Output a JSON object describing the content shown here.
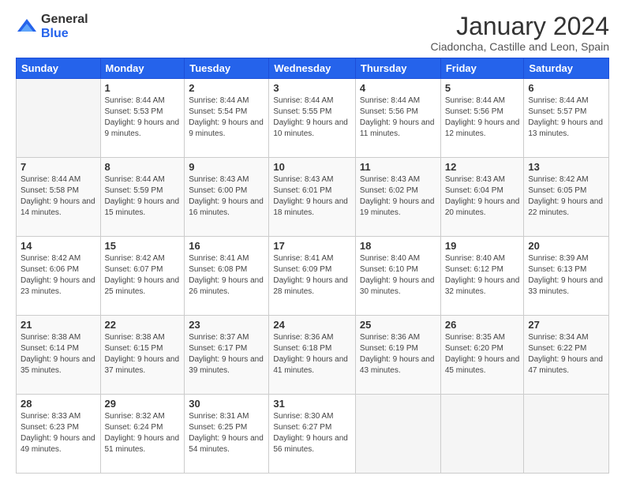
{
  "logo": {
    "general": "General",
    "blue": "Blue"
  },
  "header": {
    "month": "January 2024",
    "location": "Ciadoncha, Castille and Leon, Spain"
  },
  "weekdays": [
    "Sunday",
    "Monday",
    "Tuesday",
    "Wednesday",
    "Thursday",
    "Friday",
    "Saturday"
  ],
  "weeks": [
    [
      {
        "day": "",
        "sunrise": "",
        "sunset": "",
        "daylight": ""
      },
      {
        "day": "1",
        "sunrise": "Sunrise: 8:44 AM",
        "sunset": "Sunset: 5:53 PM",
        "daylight": "Daylight: 9 hours and 9 minutes."
      },
      {
        "day": "2",
        "sunrise": "Sunrise: 8:44 AM",
        "sunset": "Sunset: 5:54 PM",
        "daylight": "Daylight: 9 hours and 9 minutes."
      },
      {
        "day": "3",
        "sunrise": "Sunrise: 8:44 AM",
        "sunset": "Sunset: 5:55 PM",
        "daylight": "Daylight: 9 hours and 10 minutes."
      },
      {
        "day": "4",
        "sunrise": "Sunrise: 8:44 AM",
        "sunset": "Sunset: 5:56 PM",
        "daylight": "Daylight: 9 hours and 11 minutes."
      },
      {
        "day": "5",
        "sunrise": "Sunrise: 8:44 AM",
        "sunset": "Sunset: 5:56 PM",
        "daylight": "Daylight: 9 hours and 12 minutes."
      },
      {
        "day": "6",
        "sunrise": "Sunrise: 8:44 AM",
        "sunset": "Sunset: 5:57 PM",
        "daylight": "Daylight: 9 hours and 13 minutes."
      }
    ],
    [
      {
        "day": "7",
        "sunrise": "Sunrise: 8:44 AM",
        "sunset": "Sunset: 5:58 PM",
        "daylight": "Daylight: 9 hours and 14 minutes."
      },
      {
        "day": "8",
        "sunrise": "Sunrise: 8:44 AM",
        "sunset": "Sunset: 5:59 PM",
        "daylight": "Daylight: 9 hours and 15 minutes."
      },
      {
        "day": "9",
        "sunrise": "Sunrise: 8:43 AM",
        "sunset": "Sunset: 6:00 PM",
        "daylight": "Daylight: 9 hours and 16 minutes."
      },
      {
        "day": "10",
        "sunrise": "Sunrise: 8:43 AM",
        "sunset": "Sunset: 6:01 PM",
        "daylight": "Daylight: 9 hours and 18 minutes."
      },
      {
        "day": "11",
        "sunrise": "Sunrise: 8:43 AM",
        "sunset": "Sunset: 6:02 PM",
        "daylight": "Daylight: 9 hours and 19 minutes."
      },
      {
        "day": "12",
        "sunrise": "Sunrise: 8:43 AM",
        "sunset": "Sunset: 6:04 PM",
        "daylight": "Daylight: 9 hours and 20 minutes."
      },
      {
        "day": "13",
        "sunrise": "Sunrise: 8:42 AM",
        "sunset": "Sunset: 6:05 PM",
        "daylight": "Daylight: 9 hours and 22 minutes."
      }
    ],
    [
      {
        "day": "14",
        "sunrise": "Sunrise: 8:42 AM",
        "sunset": "Sunset: 6:06 PM",
        "daylight": "Daylight: 9 hours and 23 minutes."
      },
      {
        "day": "15",
        "sunrise": "Sunrise: 8:42 AM",
        "sunset": "Sunset: 6:07 PM",
        "daylight": "Daylight: 9 hours and 25 minutes."
      },
      {
        "day": "16",
        "sunrise": "Sunrise: 8:41 AM",
        "sunset": "Sunset: 6:08 PM",
        "daylight": "Daylight: 9 hours and 26 minutes."
      },
      {
        "day": "17",
        "sunrise": "Sunrise: 8:41 AM",
        "sunset": "Sunset: 6:09 PM",
        "daylight": "Daylight: 9 hours and 28 minutes."
      },
      {
        "day": "18",
        "sunrise": "Sunrise: 8:40 AM",
        "sunset": "Sunset: 6:10 PM",
        "daylight": "Daylight: 9 hours and 30 minutes."
      },
      {
        "day": "19",
        "sunrise": "Sunrise: 8:40 AM",
        "sunset": "Sunset: 6:12 PM",
        "daylight": "Daylight: 9 hours and 32 minutes."
      },
      {
        "day": "20",
        "sunrise": "Sunrise: 8:39 AM",
        "sunset": "Sunset: 6:13 PM",
        "daylight": "Daylight: 9 hours and 33 minutes."
      }
    ],
    [
      {
        "day": "21",
        "sunrise": "Sunrise: 8:38 AM",
        "sunset": "Sunset: 6:14 PM",
        "daylight": "Daylight: 9 hours and 35 minutes."
      },
      {
        "day": "22",
        "sunrise": "Sunrise: 8:38 AM",
        "sunset": "Sunset: 6:15 PM",
        "daylight": "Daylight: 9 hours and 37 minutes."
      },
      {
        "day": "23",
        "sunrise": "Sunrise: 8:37 AM",
        "sunset": "Sunset: 6:17 PM",
        "daylight": "Daylight: 9 hours and 39 minutes."
      },
      {
        "day": "24",
        "sunrise": "Sunrise: 8:36 AM",
        "sunset": "Sunset: 6:18 PM",
        "daylight": "Daylight: 9 hours and 41 minutes."
      },
      {
        "day": "25",
        "sunrise": "Sunrise: 8:36 AM",
        "sunset": "Sunset: 6:19 PM",
        "daylight": "Daylight: 9 hours and 43 minutes."
      },
      {
        "day": "26",
        "sunrise": "Sunrise: 8:35 AM",
        "sunset": "Sunset: 6:20 PM",
        "daylight": "Daylight: 9 hours and 45 minutes."
      },
      {
        "day": "27",
        "sunrise": "Sunrise: 8:34 AM",
        "sunset": "Sunset: 6:22 PM",
        "daylight": "Daylight: 9 hours and 47 minutes."
      }
    ],
    [
      {
        "day": "28",
        "sunrise": "Sunrise: 8:33 AM",
        "sunset": "Sunset: 6:23 PM",
        "daylight": "Daylight: 9 hours and 49 minutes."
      },
      {
        "day": "29",
        "sunrise": "Sunrise: 8:32 AM",
        "sunset": "Sunset: 6:24 PM",
        "daylight": "Daylight: 9 hours and 51 minutes."
      },
      {
        "day": "30",
        "sunrise": "Sunrise: 8:31 AM",
        "sunset": "Sunset: 6:25 PM",
        "daylight": "Daylight: 9 hours and 54 minutes."
      },
      {
        "day": "31",
        "sunrise": "Sunrise: 8:30 AM",
        "sunset": "Sunset: 6:27 PM",
        "daylight": "Daylight: 9 hours and 56 minutes."
      },
      {
        "day": "",
        "sunrise": "",
        "sunset": "",
        "daylight": ""
      },
      {
        "day": "",
        "sunrise": "",
        "sunset": "",
        "daylight": ""
      },
      {
        "day": "",
        "sunrise": "",
        "sunset": "",
        "daylight": ""
      }
    ]
  ]
}
